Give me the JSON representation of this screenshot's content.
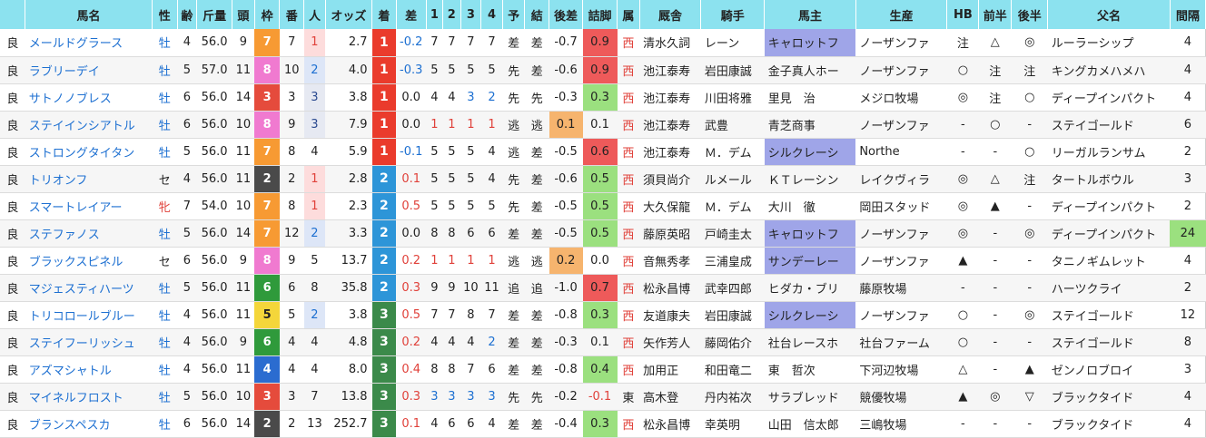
{
  "headers": [
    "馬名",
    "性",
    "齢",
    "斤量",
    "頭",
    "枠",
    "番",
    "人",
    "オッズ",
    "着",
    "差",
    "1",
    "2",
    "3",
    "4",
    "予",
    "結",
    "後差",
    "詰脚",
    "属",
    "厩舎",
    "騎手",
    "馬主",
    "生産",
    "HB",
    "前半",
    "後半",
    "父名",
    "間隔"
  ],
  "rows": [
    {
      "baba": "良",
      "name": "メールドグラース",
      "sex": "牡",
      "age": "4",
      "kinryo": "56.0",
      "heads": "9",
      "waku": "7",
      "ban": "7",
      "pop": "1",
      "odds": "2.7",
      "chaku": "1",
      "sa": "-0.2",
      "c1": "7",
      "c2": "7",
      "c3": "7",
      "c4": "7",
      "yo": "差",
      "ke": "差",
      "atosa": "-0.7",
      "tsume": "0.9",
      "zoku": "西",
      "kyusha": "清水久詞",
      "jockey": "レーン",
      "owner": "キャロットフ",
      "breeder": "ノーザンファ",
      "hb": "注",
      "zenhan": "△",
      "kohan": "◎",
      "sire": "ルーラーシップ",
      "kankaku": "4",
      "owner_hl": true,
      "breeder_hl": true,
      "kankaku_hl": false
    },
    {
      "baba": "良",
      "name": "ラブリーデイ",
      "sex": "牡",
      "age": "5",
      "kinryo": "57.0",
      "heads": "11",
      "waku": "8",
      "ban": "10",
      "pop": "2",
      "odds": "4.0",
      "chaku": "1",
      "sa": "-0.3",
      "c1": "5",
      "c2": "5",
      "c3": "5",
      "c4": "5",
      "yo": "先",
      "ke": "差",
      "atosa": "-0.6",
      "tsume": "0.9",
      "zoku": "西",
      "kyusha": "池江泰寿",
      "jockey": "岩田康誠",
      "owner": "金子真人ホー",
      "breeder": "ノーザンファ",
      "hb": "○",
      "zenhan": "注",
      "kohan": "注",
      "sire": "キングカメハメハ",
      "kankaku": "4",
      "owner_hl": false,
      "breeder_hl": true,
      "kankaku_hl": false
    },
    {
      "baba": "良",
      "name": "サトノノブレス",
      "sex": "牡",
      "age": "6",
      "kinryo": "56.0",
      "heads": "14",
      "waku": "3",
      "ban": "3",
      "pop": "3",
      "odds": "3.8",
      "chaku": "1",
      "sa": "0.0",
      "c1": "4",
      "c2": "4",
      "c3": "3",
      "c4": "2",
      "yo": "先",
      "ke": "先",
      "atosa": "-0.3",
      "tsume": "0.3",
      "zoku": "西",
      "kyusha": "池江泰寿",
      "jockey": "川田将雅",
      "owner": "里見　治",
      "breeder": "メジロ牧場",
      "hb": "◎",
      "zenhan": "注",
      "kohan": "○",
      "sire": "ディープインパクト",
      "kankaku": "4",
      "owner_hl": false,
      "breeder_hl": false,
      "kankaku_hl": false
    },
    {
      "baba": "良",
      "name": "ステイインシアトル",
      "sex": "牡",
      "age": "6",
      "kinryo": "56.0",
      "heads": "10",
      "waku": "8",
      "ban": "9",
      "pop": "3",
      "odds": "7.9",
      "chaku": "1",
      "sa": "0.0",
      "c1": "1",
      "c2": "1",
      "c3": "1",
      "c4": "1",
      "yo": "逃",
      "ke": "逃",
      "atosa": "0.1",
      "tsume": "0.1",
      "zoku": "西",
      "kyusha": "池江泰寿",
      "jockey": "武豊",
      "owner": "青芝商事",
      "breeder": "ノーザンファ",
      "hb": "-",
      "zenhan": "○",
      "kohan": "-",
      "sire": "ステイゴールド",
      "kankaku": "6",
      "owner_hl": false,
      "breeder_hl": true,
      "kankaku_hl": false
    },
    {
      "baba": "良",
      "name": "ストロングタイタン",
      "sex": "牡",
      "age": "5",
      "kinryo": "56.0",
      "heads": "11",
      "waku": "7",
      "ban": "8",
      "pop": "4",
      "odds": "5.9",
      "chaku": "1",
      "sa": "-0.1",
      "c1": "5",
      "c2": "5",
      "c3": "5",
      "c4": "4",
      "yo": "逃",
      "ke": "差",
      "atosa": "-0.5",
      "tsume": "0.6",
      "zoku": "西",
      "kyusha": "池江泰寿",
      "jockey": "Ｍ．デム",
      "owner": "シルクレーシ",
      "breeder": "Northe",
      "hb": "-",
      "zenhan": "-",
      "kohan": "○",
      "sire": "リーガルランサム",
      "kankaku": "2",
      "owner_hl": true,
      "breeder_hl": false,
      "kankaku_hl": false
    },
    {
      "baba": "良",
      "name": "トリオンフ",
      "sex": "セ",
      "age": "4",
      "kinryo": "56.0",
      "heads": "11",
      "waku": "2",
      "ban": "2",
      "pop": "1",
      "odds": "2.8",
      "chaku": "2",
      "sa": "0.1",
      "c1": "5",
      "c2": "5",
      "c3": "5",
      "c4": "4",
      "yo": "先",
      "ke": "差",
      "atosa": "-0.6",
      "tsume": "0.5",
      "zoku": "西",
      "kyusha": "須貝尚介",
      "jockey": "ルメール",
      "owner": "ＫＴレーシン",
      "breeder": "レイクヴィラ",
      "hb": "◎",
      "zenhan": "△",
      "kohan": "注",
      "sire": "タートルボウル",
      "kankaku": "3",
      "owner_hl": false,
      "breeder_hl": false,
      "kankaku_hl": false
    },
    {
      "baba": "良",
      "name": "スマートレイアー",
      "sex": "牝",
      "age": "7",
      "kinryo": "54.0",
      "heads": "10",
      "waku": "7",
      "ban": "8",
      "pop": "1",
      "odds": "2.3",
      "chaku": "2",
      "sa": "0.5",
      "c1": "5",
      "c2": "5",
      "c3": "5",
      "c4": "5",
      "yo": "先",
      "ke": "差",
      "atosa": "-0.5",
      "tsume": "0.5",
      "zoku": "西",
      "kyusha": "大久保龍",
      "jockey": "Ｍ．デム",
      "owner": "大川　徹",
      "breeder": "岡田スタッド",
      "hb": "◎",
      "zenhan": "▲",
      "kohan": "-",
      "sire": "ディープインパクト",
      "kankaku": "2",
      "owner_hl": false,
      "breeder_hl": false,
      "kankaku_hl": false
    },
    {
      "baba": "良",
      "name": "ステファノス",
      "sex": "牡",
      "age": "5",
      "kinryo": "56.0",
      "heads": "14",
      "waku": "7",
      "ban": "12",
      "pop": "2",
      "odds": "3.3",
      "chaku": "2",
      "sa": "0.0",
      "c1": "8",
      "c2": "8",
      "c3": "6",
      "c4": "6",
      "yo": "差",
      "ke": "差",
      "atosa": "-0.5",
      "tsume": "0.5",
      "zoku": "西",
      "kyusha": "藤原英昭",
      "jockey": "戸崎圭太",
      "owner": "キャロットフ",
      "breeder": "ノーザンファ",
      "hb": "◎",
      "zenhan": "-",
      "kohan": "◎",
      "sire": "ディープインパクト",
      "kankaku": "24",
      "owner_hl": true,
      "breeder_hl": true,
      "kankaku_hl": true
    },
    {
      "baba": "良",
      "name": "ブラックスピネル",
      "sex": "セ",
      "age": "6",
      "kinryo": "56.0",
      "heads": "9",
      "waku": "8",
      "ban": "9",
      "pop": "5",
      "odds": "13.7",
      "chaku": "2",
      "sa": "0.2",
      "c1": "1",
      "c2": "1",
      "c3": "1",
      "c4": "1",
      "yo": "逃",
      "ke": "逃",
      "atosa": "0.2",
      "tsume": "0.0",
      "zoku": "西",
      "kyusha": "音無秀孝",
      "jockey": "三浦皇成",
      "owner": "サンデーレー",
      "breeder": "ノーザンファ",
      "hb": "▲",
      "zenhan": "-",
      "kohan": "-",
      "sire": "タニノギムレット",
      "kankaku": "4",
      "owner_hl": true,
      "breeder_hl": true,
      "kankaku_hl": false
    },
    {
      "baba": "良",
      "name": "マジェスティハーツ",
      "sex": "牡",
      "age": "5",
      "kinryo": "56.0",
      "heads": "11",
      "waku": "6",
      "ban": "6",
      "pop": "8",
      "odds": "35.8",
      "chaku": "2",
      "sa": "0.3",
      "c1": "9",
      "c2": "9",
      "c3": "10",
      "c4": "11",
      "yo": "追",
      "ke": "追",
      "atosa": "-1.0",
      "tsume": "0.7",
      "zoku": "西",
      "kyusha": "松永昌博",
      "jockey": "武幸四郎",
      "owner": "ヒダカ・ブリ",
      "breeder": "藤原牧場",
      "hb": "-",
      "zenhan": "-",
      "kohan": "-",
      "sire": "ハーツクライ",
      "kankaku": "2",
      "owner_hl": false,
      "breeder_hl": false,
      "kankaku_hl": false
    },
    {
      "baba": "良",
      "name": "トリコロールブルー",
      "sex": "牡",
      "age": "4",
      "kinryo": "56.0",
      "heads": "11",
      "waku": "5",
      "ban": "5",
      "pop": "2",
      "odds": "3.8",
      "chaku": "3",
      "sa": "0.5",
      "c1": "7",
      "c2": "7",
      "c3": "8",
      "c4": "7",
      "yo": "差",
      "ke": "差",
      "atosa": "-0.8",
      "tsume": "0.3",
      "zoku": "西",
      "kyusha": "友道康夫",
      "jockey": "岩田康誠",
      "owner": "シルクレーシ",
      "breeder": "ノーザンファ",
      "hb": "○",
      "zenhan": "-",
      "kohan": "◎",
      "sire": "ステイゴールド",
      "kankaku": "12",
      "owner_hl": true,
      "breeder_hl": true,
      "kankaku_hl": false
    },
    {
      "baba": "良",
      "name": "ステイフーリッシュ",
      "sex": "牡",
      "age": "4",
      "kinryo": "56.0",
      "heads": "9",
      "waku": "6",
      "ban": "4",
      "pop": "4",
      "odds": "4.8",
      "chaku": "3",
      "sa": "0.2",
      "c1": "4",
      "c2": "4",
      "c3": "4",
      "c4": "2",
      "yo": "差",
      "ke": "差",
      "atosa": "-0.3",
      "tsume": "0.1",
      "zoku": "西",
      "kyusha": "矢作芳人",
      "jockey": "藤岡佑介",
      "owner": "社台レースホ",
      "breeder": "社台ファーム",
      "hb": "○",
      "zenhan": "-",
      "kohan": "-",
      "sire": "ステイゴールド",
      "kankaku": "8",
      "owner_hl": false,
      "breeder_hl": false,
      "kankaku_hl": false
    },
    {
      "baba": "良",
      "name": "アズマシャトル",
      "sex": "牡",
      "age": "4",
      "kinryo": "56.0",
      "heads": "11",
      "waku": "4",
      "ban": "4",
      "pop": "4",
      "odds": "8.0",
      "chaku": "3",
      "sa": "0.4",
      "c1": "8",
      "c2": "8",
      "c3": "7",
      "c4": "6",
      "yo": "差",
      "ke": "差",
      "atosa": "-0.8",
      "tsume": "0.4",
      "zoku": "西",
      "kyusha": "加用正",
      "jockey": "和田竜二",
      "owner": "東　哲次",
      "breeder": "下河辺牧場",
      "hb": "△",
      "zenhan": "-",
      "kohan": "▲",
      "sire": "ゼンノロブロイ",
      "kankaku": "3",
      "owner_hl": false,
      "breeder_hl": false,
      "kankaku_hl": false
    },
    {
      "baba": "良",
      "name": "マイネルフロスト",
      "sex": "牡",
      "age": "5",
      "kinryo": "56.0",
      "heads": "10",
      "waku": "3",
      "ban": "3",
      "pop": "7",
      "odds": "13.8",
      "chaku": "3",
      "sa": "0.3",
      "c1": "3",
      "c2": "3",
      "c3": "3",
      "c4": "3",
      "yo": "先",
      "ke": "先",
      "atosa": "-0.2",
      "tsume": "-0.1",
      "zoku": "東",
      "kyusha": "高木登",
      "jockey": "丹内祐次",
      "owner": "サラブレッド",
      "breeder": "競優牧場",
      "hb": "▲",
      "zenhan": "◎",
      "kohan": "▽",
      "sire": "ブラックタイド",
      "kankaku": "4",
      "owner_hl": false,
      "breeder_hl": false,
      "kankaku_hl": false
    },
    {
      "baba": "良",
      "name": "ブランスペスカ",
      "sex": "牡",
      "age": "6",
      "kinryo": "56.0",
      "heads": "14",
      "waku": "2",
      "ban": "2",
      "pop": "13",
      "odds": "252.7",
      "chaku": "3",
      "sa": "0.1",
      "c1": "4",
      "c2": "6",
      "c3": "6",
      "c4": "4",
      "yo": "差",
      "ke": "差",
      "atosa": "-0.4",
      "tsume": "0.3",
      "zoku": "西",
      "kyusha": "松永昌博",
      "jockey": "幸英明",
      "owner": "山田　信太郎",
      "breeder": "三嶋牧場",
      "hb": "-",
      "zenhan": "-",
      "kohan": "-",
      "sire": "ブラックタイド",
      "kankaku": "4",
      "owner_hl": false,
      "breeder_hl": false,
      "kankaku_hl": false
    }
  ]
}
